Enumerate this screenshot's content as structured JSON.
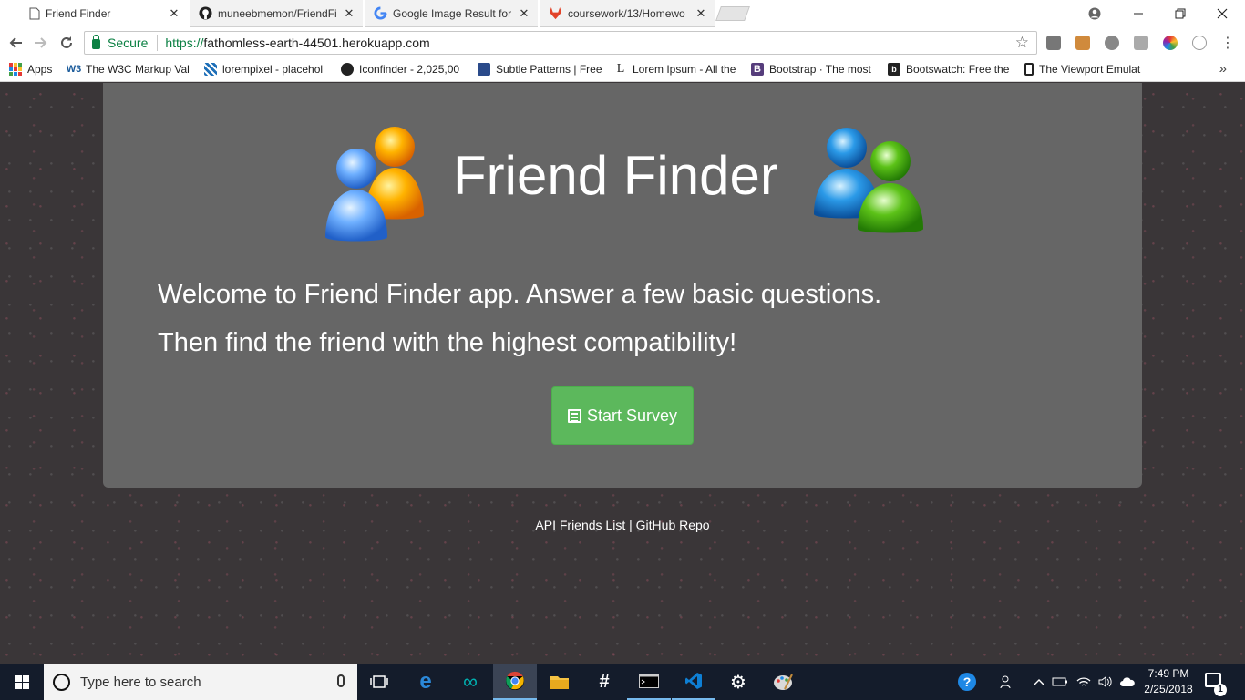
{
  "browser": {
    "tabs": [
      {
        "title": "Friend Finder",
        "icon": "page-icon",
        "active": true
      },
      {
        "title": "muneebmemon/FriendFi",
        "icon": "github-icon",
        "active": false
      },
      {
        "title": "Google Image Result for",
        "icon": "google-icon",
        "active": false
      },
      {
        "title": "coursework/13/Homewo",
        "icon": "gitlab-icon",
        "active": false
      }
    ],
    "close_glyph": "✕",
    "address": {
      "secure_label": "Secure",
      "scheme": "https://",
      "host": "fathomless-earth-44501.herokuapp.com"
    },
    "bookmarks": [
      {
        "label": "Apps",
        "icon": "apps-icon"
      },
      {
        "label": "The W3C Markup Val",
        "icon": "w3c-icon"
      },
      {
        "label": "lorempixel - placehol",
        "icon": "lorempixel-icon"
      },
      {
        "label": "Iconfinder - 2,025,00",
        "icon": "iconfinder-icon"
      },
      {
        "label": "Subtle Patterns | Free",
        "icon": "subtle-patterns-icon"
      },
      {
        "label": "Lorem Ipsum - All the",
        "icon": "lorem-ipsum-icon"
      },
      {
        "label": "Bootstrap · The most",
        "icon": "bootstrap-icon"
      },
      {
        "label": "Bootswatch: Free the",
        "icon": "bootswatch-icon"
      },
      {
        "label": "The Viewport Emulat",
        "icon": "viewport-icon"
      }
    ],
    "more_bookmarks": "»"
  },
  "page": {
    "title": "Friend Finder",
    "lead_line_1": "Welcome to Friend Finder app. Answer a few basic questions.",
    "lead_line_2": "Then find the friend with the highest compatibility!",
    "start_button": "Start Survey",
    "footer": {
      "api_link": "API Friends List",
      "separator": " | ",
      "github_link": "GitHub Repo"
    }
  },
  "taskbar": {
    "search_placeholder": "Type here to search",
    "time": "7:49 PM",
    "date": "2/25/2018",
    "notification_count": "1"
  },
  "colors": {
    "jumbotron": "#666666",
    "page_bg": "#3a3638",
    "button": "#5cb85c",
    "taskbar": "#141c2b",
    "secure_green": "#0b8043"
  }
}
